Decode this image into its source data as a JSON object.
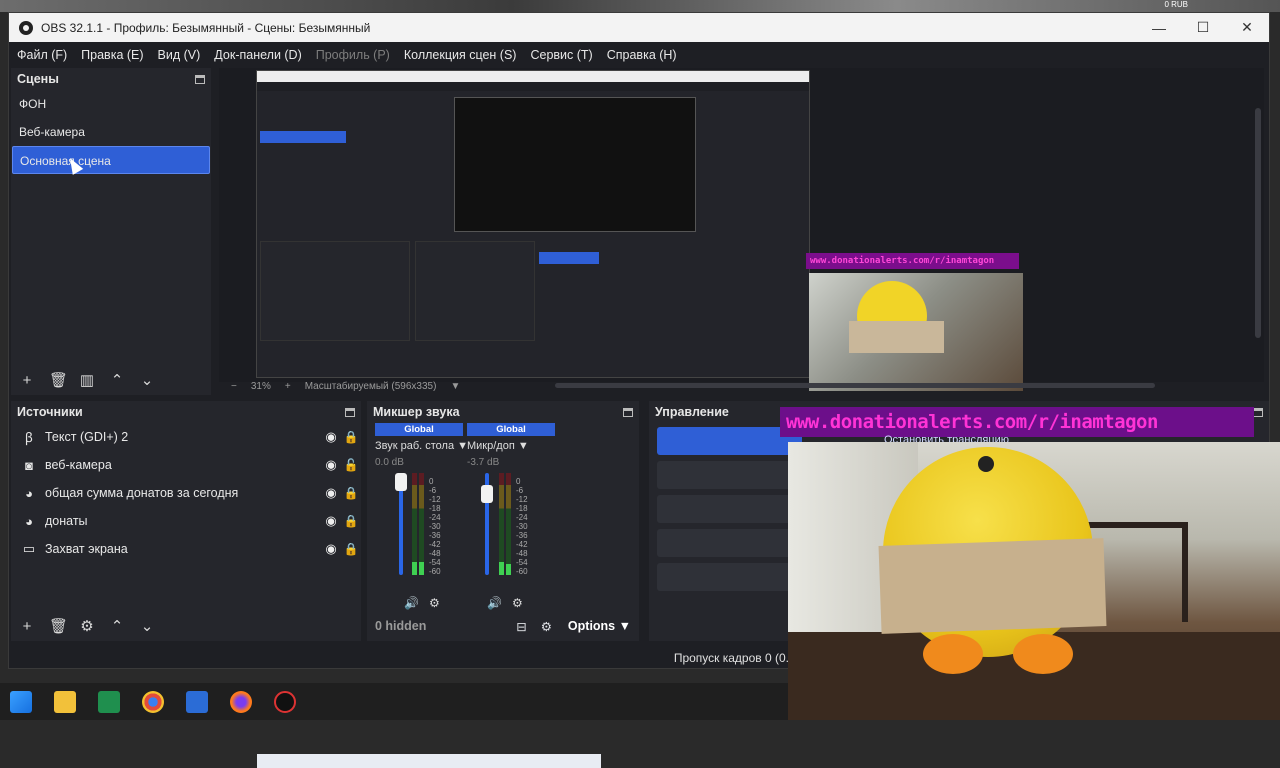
{
  "desktop": {
    "corner_text": "0 RUB"
  },
  "window": {
    "title": "OBS 32.1.1 - Профиль: Безымянный - Сцены: Безымянный"
  },
  "menu": [
    {
      "label": "Файл (F)",
      "disabled": false
    },
    {
      "label": "Правка (E)",
      "disabled": false
    },
    {
      "label": "Вид (V)",
      "disabled": false
    },
    {
      "label": "Док-панели (D)",
      "disabled": false
    },
    {
      "label": "Профиль (P)",
      "disabled": true
    },
    {
      "label": "Коллекция сцен (S)",
      "disabled": false
    },
    {
      "label": "Сервис (T)",
      "disabled": false
    },
    {
      "label": "Справка (H)",
      "disabled": false
    }
  ],
  "scenes": {
    "title": "Сцены",
    "items": [
      "ФОН",
      "Веб-камера",
      "Основная сцена"
    ],
    "selected_index": 2
  },
  "preview": {
    "zoom": "31%",
    "scale_mode": "Масштабируемый (596x335)"
  },
  "sources": {
    "title": "Источники",
    "items": [
      {
        "label": "Текст (GDI+) 2",
        "icon": "text-icon",
        "locked": true
      },
      {
        "label": "веб-камера",
        "icon": "camera-icon",
        "locked": false
      },
      {
        "label": "общая сумма донатов за сегодня",
        "icon": "browser-icon",
        "locked": true
      },
      {
        "label": "донаты",
        "icon": "browser-icon",
        "locked": true
      },
      {
        "label": "Захват экрана",
        "icon": "monitor-icon",
        "locked": true
      }
    ]
  },
  "mixer": {
    "title": "Микшер звука",
    "channels": [
      {
        "tag": "Global",
        "name": "Звук раб. стола",
        "db": "0.0 dB",
        "level": 0.85
      },
      {
        "tag": "Global",
        "name": "Микр/доп",
        "db": "-3.7 dB",
        "level": 0.75
      }
    ],
    "scale": [
      "0",
      "-6",
      "-12",
      "-18",
      "-24",
      "-30",
      "-36",
      "-42",
      "-48",
      "-54",
      "-60"
    ],
    "hidden_label": "0 hidden",
    "options_label": "Options"
  },
  "control": {
    "title": "Управление",
    "start_stream_label": "Остановить трансляцию"
  },
  "status": {
    "dropped_frames": "Пропуск кадров 0 (0."
  },
  "overlay": {
    "donation_url": "www.donationalerts.com/r/inamtagon",
    "donation_url_small": "www.donationalerts.com/r/inamtagon"
  },
  "colors": {
    "accent": "#2f5fd6",
    "banner_bg": "#6c0f8a",
    "banner_text": "#ff33d6"
  }
}
